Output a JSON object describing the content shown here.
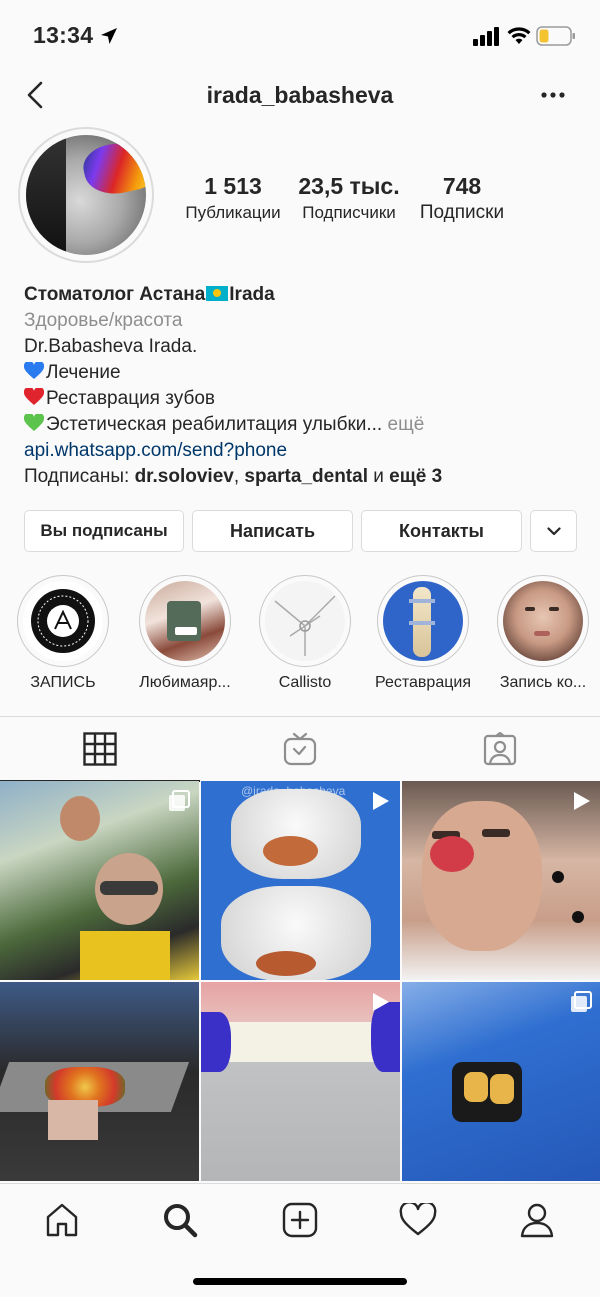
{
  "status_bar": {
    "time": "13:34"
  },
  "header": {
    "username": "irada_babasheva"
  },
  "profile": {
    "stats": [
      {
        "value": "1 513",
        "label": "Публикации"
      },
      {
        "value": "23,5 тыс.",
        "label": "Подписчики"
      },
      {
        "value": "748",
        "label": "Подписки"
      }
    ]
  },
  "bio": {
    "name_part1": "Стоматолог Астана",
    "name_part2": "Irada",
    "category": "Здоровье/красота",
    "line1": "Dr.Babasheva Irada.",
    "line2": "Лечение",
    "line3": "Реставрация зубов",
    "line4": "Эстетическая реабилитация улыбки...",
    "more": "ещё",
    "link": "api.whatsapp.com/send?phone",
    "followed_prefix": "Подписаны: ",
    "followed_user1": "dr.soloviev",
    "followed_sep": ", ",
    "followed_user2": "sparta_dental",
    "followed_and": " и ",
    "followed_more": "ещё 3"
  },
  "actions": {
    "following": "Вы подписаны",
    "message": "Написать",
    "contacts": "Контакты"
  },
  "highlights": [
    {
      "label": "ЗАПИСЬ"
    },
    {
      "label": "Любимаяр..."
    },
    {
      "label": "Callisto"
    },
    {
      "label": "Реставрация"
    },
    {
      "label": "Запись ко..."
    }
  ],
  "grid_watermark": "@irada_babasheva",
  "colors": {
    "link": "#00376b",
    "secondary_text": "#8e8e8e",
    "border": "#dbdbdb",
    "blue_heart": "#2b7bf0",
    "red_heart": "#e0242e",
    "green_heart": "#5cc44c"
  }
}
